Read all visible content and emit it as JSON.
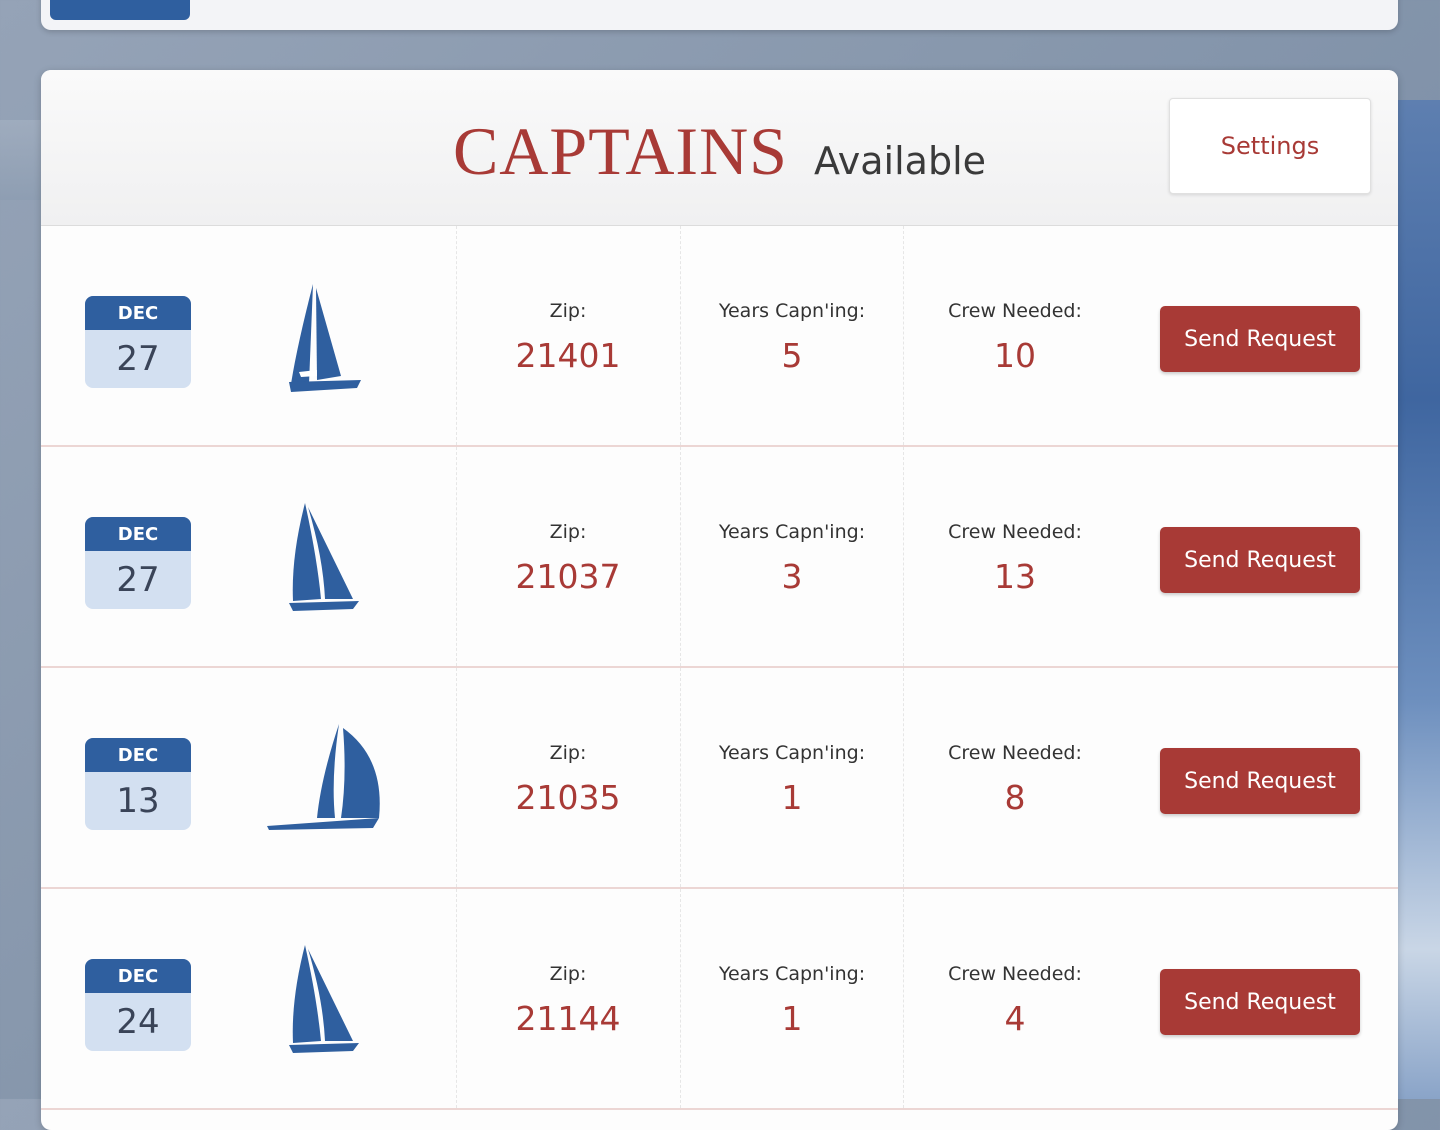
{
  "header": {
    "title": "CAPTAINS",
    "subtitle": "Available",
    "settings_label": "Settings"
  },
  "colors": {
    "accent": "#a83a36",
    "brand_blue": "#2f5f9f",
    "calendar_bg": "#d3e0f1"
  },
  "labels": {
    "zip": "Zip:",
    "years": "Years Capn'ing:",
    "crew": "Crew Needed:",
    "send": "Send Request"
  },
  "captains": [
    {
      "month": "DEC",
      "day": "27",
      "boat_icon": "sailboat-icon",
      "zip": "21401",
      "years": "5",
      "crew": "10"
    },
    {
      "month": "DEC",
      "day": "27",
      "boat_icon": "sailboat-icon",
      "zip": "21037",
      "years": "3",
      "crew": "13"
    },
    {
      "month": "DEC",
      "day": "13",
      "boat_icon": "sailboat-spinnaker-icon",
      "zip": "21035",
      "years": "1",
      "crew": "8"
    },
    {
      "month": "DEC",
      "day": "24",
      "boat_icon": "sailboat-icon",
      "zip": "21144",
      "years": "1",
      "crew": "4"
    }
  ]
}
